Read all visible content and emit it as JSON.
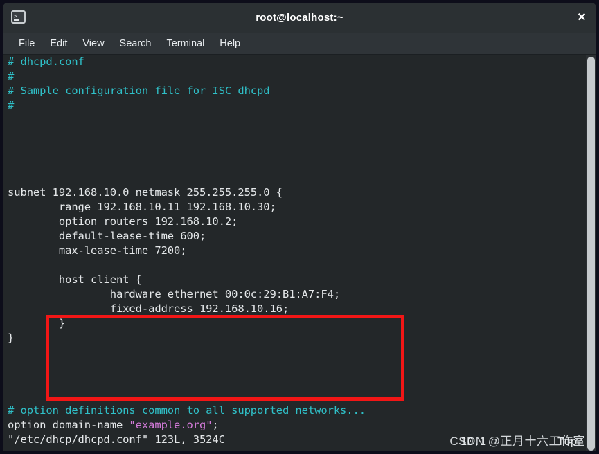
{
  "window": {
    "title": "root@localhost:~",
    "icon": "terminal-icon",
    "close_label": "✕",
    "prompt_glyph": ">_"
  },
  "menubar": {
    "items": [
      {
        "label": "File"
      },
      {
        "label": "Edit"
      },
      {
        "label": "View"
      },
      {
        "label": "Search"
      },
      {
        "label": "Terminal"
      },
      {
        "label": "Help"
      }
    ]
  },
  "terminal": {
    "lines": [
      {
        "text": "# dhcpd.conf",
        "style": "comment"
      },
      {
        "text": "#",
        "style": "comment"
      },
      {
        "text": "# Sample configuration file for ISC dhcpd",
        "style": "comment"
      },
      {
        "text": "#",
        "style": "comment"
      },
      {
        "text": "",
        "style": "plain"
      },
      {
        "text": "",
        "style": "plain"
      },
      {
        "text": "",
        "style": "plain"
      },
      {
        "text": "",
        "style": "plain"
      },
      {
        "text": "",
        "style": "plain"
      },
      {
        "text": "subnet 192.168.10.0 netmask 255.255.255.0 {",
        "style": "plain"
      },
      {
        "text": "        range 192.168.10.11 192.168.10.30;",
        "style": "plain"
      },
      {
        "text": "        option routers 192.168.10.2;",
        "style": "plain"
      },
      {
        "text": "        default-lease-time 600;",
        "style": "plain"
      },
      {
        "text": "        max-lease-time 7200;",
        "style": "plain"
      },
      {
        "text": "",
        "style": "plain"
      },
      {
        "text": "        host client {",
        "style": "plain"
      },
      {
        "text": "                hardware ethernet 00:0c:29:B1:A7:F4;",
        "style": "plain"
      },
      {
        "text": "                fixed-address 192.168.10.16;",
        "style": "plain"
      },
      {
        "text": "        }",
        "style": "plain"
      },
      {
        "text": "}",
        "style": "plain"
      },
      {
        "text": "",
        "style": "plain"
      },
      {
        "text": "",
        "style": "plain"
      },
      {
        "text": "",
        "style": "plain"
      },
      {
        "text": "",
        "style": "plain"
      },
      {
        "text": "# option definitions common to all supported networks...",
        "style": "comment"
      },
      {
        "text": "option domain-name ",
        "style": "plain",
        "suffix_string": "\"example.org\"",
        "suffix_plain": ";"
      },
      {
        "text": "\"/etc/dhcp/dhcpd.conf\" 123L, 3524C",
        "style": "plain"
      }
    ],
    "ruler": "10,1           Top",
    "watermark": "CSDN @正月十六工作室"
  },
  "annotation": {
    "name": "red-highlight-box",
    "color": "#f21616"
  },
  "colors": {
    "background": "#232729",
    "titlebar": "#2b3033",
    "menubar": "#2f3438",
    "foreground": "#e4e7e9",
    "comment": "#2fc0c8",
    "string": "#d27ad8",
    "scrollbar": "#c6cacd"
  }
}
